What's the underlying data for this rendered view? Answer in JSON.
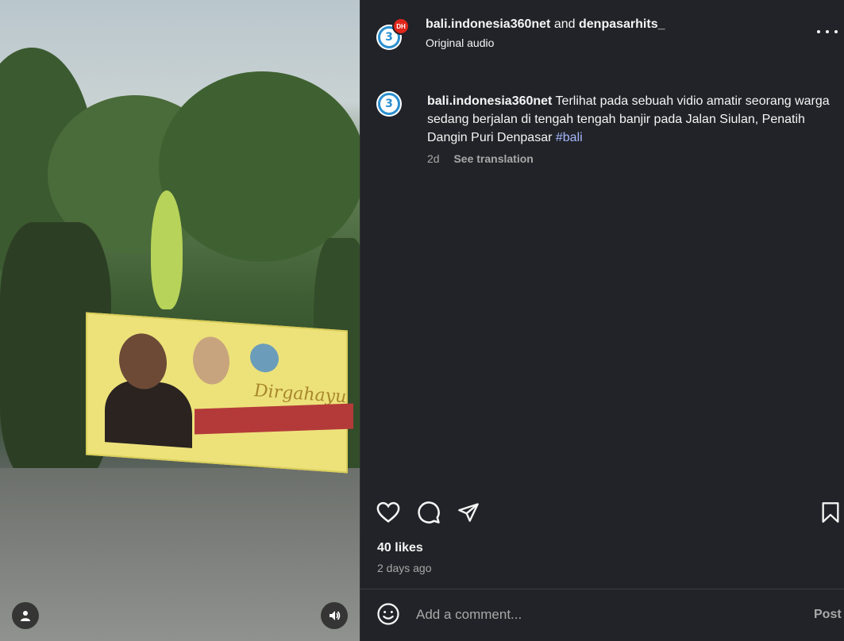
{
  "header": {
    "author1": "bali.indonesia360net",
    "conjunction": "and",
    "author2": "denpasarhits_",
    "audio": "Original audio",
    "badge_text": "DH"
  },
  "caption": {
    "username": "bali.indonesia360net",
    "text": "Terlihat pada sebuah vidio amatir seorang warga sedang berjalan di tengah tengah banjir pada Jalan Siulan, Penatih Dangin Puri Denpasar",
    "hashtag": "#bali",
    "time": "2d",
    "see_translation": "See translation"
  },
  "avatar_glyph": "3",
  "banner": {
    "script_text": "Dirgahayu"
  },
  "stats": {
    "likes": "40 likes",
    "posted": "2 days ago"
  },
  "comment": {
    "placeholder": "Add a comment...",
    "post_label": "Post"
  },
  "icons": {
    "like": "heart-icon",
    "comment": "comment-icon",
    "share": "share-icon",
    "save": "bookmark-icon",
    "more": "more-icon",
    "emoji": "emoji-icon",
    "user": "user-icon",
    "sound": "volume-icon"
  },
  "colors": {
    "panel_bg": "#212328",
    "text": "#f5f5f5",
    "muted": "#a8a8a8",
    "hashtag": "#a4b8ff",
    "avatar_ring": "#2b8fcf",
    "badge_red": "#e0261b"
  }
}
